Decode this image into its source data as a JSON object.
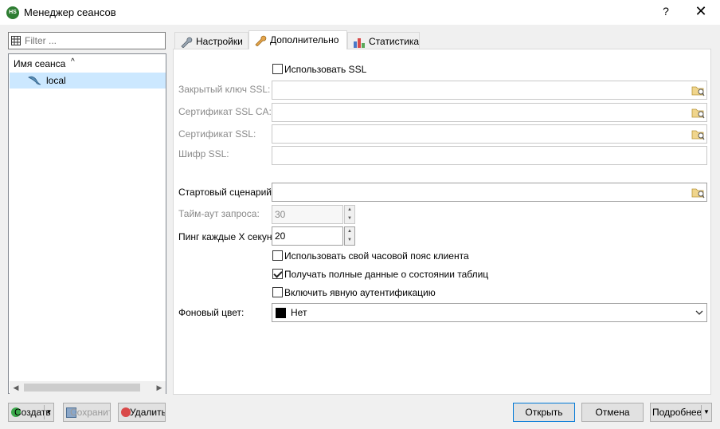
{
  "window": {
    "title": "Менеджер сеансов",
    "help": "?",
    "close": "✕",
    "app_icon_text": "HS"
  },
  "filter": {
    "placeholder": "Filter ..."
  },
  "tree": {
    "column_header": "Имя сеанса",
    "sessions": [
      {
        "label": "local",
        "selected": true
      }
    ]
  },
  "tabs": [
    {
      "label": "Настройки",
      "icon": "wrench-icon",
      "active": false
    },
    {
      "label": "Дополнительно",
      "icon": "wrench-orange-icon",
      "active": true
    },
    {
      "label": "Статистика",
      "icon": "bar-chart-icon",
      "active": false
    }
  ],
  "advanced": {
    "use_ssl": {
      "label": "Использовать SSL",
      "checked": false
    },
    "ssl_key": {
      "label": "Закрытый ключ SSL:",
      "value": ""
    },
    "ssl_ca": {
      "label": "Сертификат SSL CA:",
      "value": ""
    },
    "ssl_cert": {
      "label": "Сертификат SSL:",
      "value": ""
    },
    "ssl_cipher": {
      "label": "Шифр SSL:",
      "value": ""
    },
    "startup_script": {
      "label": "Стартовый сценарий:",
      "value": ""
    },
    "query_timeout": {
      "label": "Тайм-аут запроса:",
      "value": "30"
    },
    "ping_every": {
      "label": "Пинг каждые X секунд:",
      "value": "20"
    },
    "local_tz": {
      "label": "Использовать свой часовой пояс клиента",
      "checked": false
    },
    "full_table_status": {
      "label": "Получать полные данные о состоянии таблиц",
      "checked": true
    },
    "cleartext_auth": {
      "label": "Включить явную аутентификацию",
      "checked": false
    },
    "bg_color": {
      "label": "Фоновый цвет:",
      "value": "Нет",
      "swatch": "#000000"
    }
  },
  "buttons": {
    "new": "Создать",
    "save": "Сохранить",
    "delete": "Удалить",
    "open": "Открыть",
    "cancel": "Отмена",
    "more": "Подробнее"
  },
  "colors": {
    "selection": "#cce8ff",
    "primary_border": "#0078d7"
  }
}
